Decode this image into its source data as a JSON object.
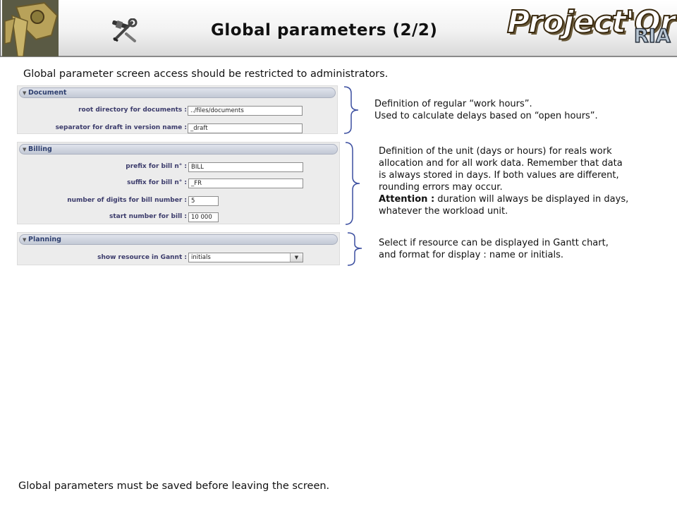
{
  "header": {
    "title": "Global parameters (2/2)",
    "brand_main": "Project'Or",
    "brand_sub": "RIA",
    "logo_icon": "camera-tripod-logo",
    "tool_icon": "tools-icon"
  },
  "notes": {
    "top": "Global parameter screen access should be restricted to administrators.",
    "bottom": "Global parameters must be saved before leaving the screen."
  },
  "document": {
    "title": "Document",
    "fields": [
      {
        "label": "root directory for documents :",
        "value": "../files/documents"
      },
      {
        "label": "separator for draft in version name :",
        "value": "_draft"
      }
    ],
    "desc": [
      "Definition of regular “work hours”.",
      "Used to calculate delays based on “open hours”."
    ]
  },
  "billing": {
    "title": "Billing",
    "fields": [
      {
        "label": "prefix for bill n° :",
        "value": "BILL"
      },
      {
        "label": "suffix for bill n° :",
        "value": "_FR"
      },
      {
        "label": "number of digits for bill number :",
        "value": "5"
      },
      {
        "label": "start number for bill :",
        "value": "10 000"
      }
    ],
    "desc_lines": [
      "Definition of the unit (days or hours) for reals work",
      "allocation and for all work data. Remember that data",
      "is always stored in days. If both values are different,",
      "rounding errors may occur."
    ],
    "desc_attention_label": "Attention :",
    "desc_attention_text": " duration will always be displayed in days,",
    "desc_last": "whatever the workload unit."
  },
  "planning": {
    "title": "Planning",
    "fields": [
      {
        "label": "show resource in Gannt :",
        "value": "initials"
      }
    ],
    "desc": [
      "Select if resource can be displayed in Gantt chart,",
      "and format for display : name or initials."
    ]
  },
  "colors": {
    "brace": "#3c4fa0",
    "panel_title": "#2e3f6f"
  }
}
